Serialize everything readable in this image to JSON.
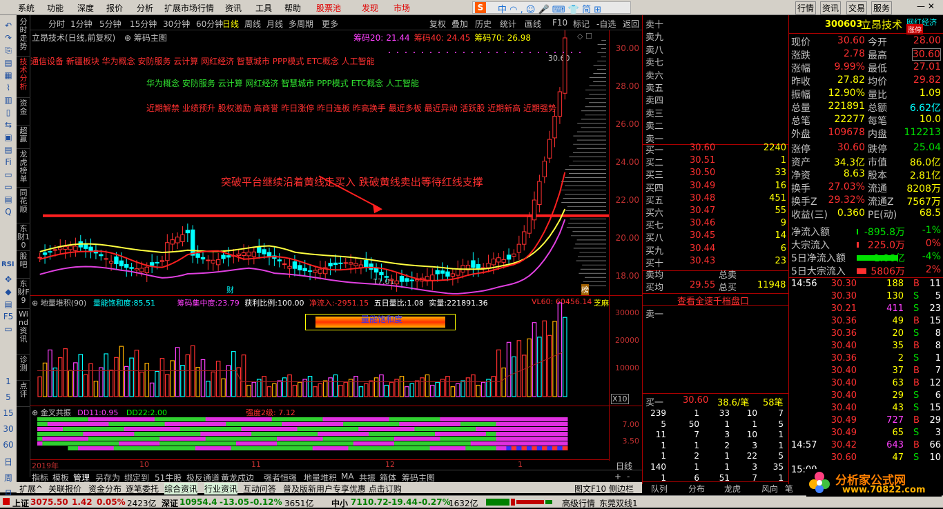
{
  "menu": {
    "items": [
      "系统",
      "功能",
      "深度",
      "报价",
      "分析",
      "扩展市场行情",
      "资讯",
      "工具",
      "帮助"
    ],
    "stock_pool": "股票池",
    "discover": "发现",
    "market": "市场",
    "right_items": [
      "行情",
      "资讯",
      "交易",
      "服务"
    ]
  },
  "vtabs": [
    "分时走势",
    "技术分析",
    "资金",
    "超赢",
    "龙虎榜单",
    "同花顺",
    "东财10",
    "股吧",
    "东财F9",
    "Wind资讯",
    "诊测",
    "点评"
  ],
  "left_numbers": [
    "1",
    "5",
    "15",
    "30",
    "60",
    "日",
    "周",
    "月"
  ],
  "toolbar": {
    "periods": [
      "分时",
      "1分钟",
      "5分钟",
      "15分钟",
      "30分钟",
      "60分钟",
      "日线",
      "周线",
      "月线",
      "多周期",
      "更多"
    ],
    "active": "日线",
    "tools": [
      "复权",
      "叠加",
      "历史",
      "统计",
      "画线",
      "F10",
      "标记",
      "-自选",
      "返回"
    ]
  },
  "chart": {
    "title": "立昂技术(日线,前复权)",
    "indicator": "筹码主图",
    "chips": [
      {
        "label": "筹码20:",
        "value": "21.44",
        "color": "#ff40ff"
      },
      {
        "label": "筹码40:",
        "value": "24.45",
        "color": "#ff3030"
      },
      {
        "label": "筹码70:",
        "value": "26.98",
        "color": "#ffff00"
      }
    ],
    "concept_line1": "通信设备 新疆板块 华为概念 安防服务 云计算 网红经济 智慧城市 PPP模式 ETC概念 人工智能",
    "concept_line2": "华为概念 安防服务 云计算 网红经济 智慧城市 PPP模式 ETC概念 人工智能",
    "tags_line": "近期解禁 业绩预升 股权激励 高商誉 昨日涨停 昨日连板 昨高换手 最近多板 最近异动 活跃股 近期新高 近期强势",
    "annotation": "突破平台继续沿着黄线走买入 跌破黄线卖出等待红线支撑",
    "high_label": "30.60",
    "low_label": "17.01",
    "marker_cai": "财",
    "marker_bang": "榜",
    "price_ticks": [
      "30.00",
      "28.00",
      "26.00",
      "24.00",
      "22.00",
      "20.00",
      "18.00"
    ]
  },
  "chart_data": {
    "type": "candlestick",
    "series": [
      {
        "name": "筹码20",
        "last": 21.44
      },
      {
        "name": "筹码40",
        "last": 24.45
      },
      {
        "name": "筹码70",
        "last": 26.98
      }
    ],
    "high": 30.6,
    "low": 17.01,
    "ylim": [
      17,
      31
    ]
  },
  "vol": {
    "title": "地量堆积(90)",
    "sat_label": "量能饱和度:",
    "sat_value": "85.51",
    "conc_label": "筹码集中度:",
    "conc_value": "23.79",
    "profit_label": "获利比例:",
    "profit_value": "100.00",
    "inflow_label": "净流入:",
    "inflow_value": "-2951.15",
    "ratio_label": "五日量比:",
    "ratio_value": "1.08",
    "real_label": "实量:",
    "real_value": "221891.36",
    "vl60": "VL60: 60456.14",
    "box_label": "量能饱和度",
    "extra": "芝麻",
    "ticks": [
      "30000",
      "20000",
      "10000"
    ],
    "x10": "X10"
  },
  "kd": {
    "title": "金叉共振",
    "dd11_label": "DD11:",
    "dd11": "0.95",
    "dd22_label": "DD22:",
    "dd22": "2.00",
    "strength": "强度2级: 7.12",
    "ticks": [
      "7.00",
      "3.50"
    ]
  },
  "dates": {
    "year": "2019年",
    "m10": "10",
    "m11": "11",
    "m12": "12",
    "m1": "1",
    "period": "日线"
  },
  "bottomtabs": [
    "指标",
    "模板",
    "管理",
    "另存为",
    "绑定到",
    "51牛股",
    "极反通道",
    "黄龙戍边",
    "强者恒强",
    "地量堆积",
    "MA",
    "共振",
    "箱体",
    "筹码主图"
  ],
  "subtabs": [
    "扩展^",
    "关联报价",
    "资金分布",
    "逐笔委托",
    "综合资讯",
    "行业资讯",
    "互动问答",
    "普及版新用户专享优惠 点击订购"
  ],
  "sidebar_label": "图文F10 侧边栏",
  "status": {
    "sh_name": "上证",
    "sh_price": "3075.50",
    "sh_chg": "1.42",
    "sh_pct": "0.05%",
    "sh_amt": "2423亿",
    "sz_name": "深证",
    "sz_price": "10954.4",
    "sz_chg": "-13.05",
    "sz_pct": "-0.12%",
    "sz_amt": "3651亿",
    "zx_name": "中小",
    "zx_price": "7110.72",
    "zx_chg": "-19.44",
    "zx_pct": "-0.27%",
    "zx_amt": "1632亿",
    "server": "高级行情_东莞双线1"
  },
  "orderbook": {
    "sells": [
      {
        "l": "卖十",
        "p": "",
        "v": ""
      },
      {
        "l": "卖九",
        "p": "",
        "v": ""
      },
      {
        "l": "卖八",
        "p": "",
        "v": ""
      },
      {
        "l": "卖七",
        "p": "",
        "v": ""
      },
      {
        "l": "卖六",
        "p": "",
        "v": ""
      },
      {
        "l": "卖五",
        "p": "",
        "v": ""
      },
      {
        "l": "卖四",
        "p": "",
        "v": ""
      },
      {
        "l": "卖三",
        "p": "",
        "v": ""
      },
      {
        "l": "卖二",
        "p": "",
        "v": ""
      },
      {
        "l": "卖一",
        "p": "",
        "v": ""
      }
    ],
    "buys": [
      {
        "l": "买一",
        "p": "30.60",
        "v": "2240"
      },
      {
        "l": "买二",
        "p": "30.51",
        "v": "1"
      },
      {
        "l": "买三",
        "p": "30.50",
        "v": "33"
      },
      {
        "l": "买四",
        "p": "30.49",
        "v": "16"
      },
      {
        "l": "买五",
        "p": "30.48",
        "v": "451"
      },
      {
        "l": "买六",
        "p": "30.47",
        "v": "55"
      },
      {
        "l": "买七",
        "p": "30.46",
        "v": "9"
      },
      {
        "l": "买八",
        "p": "30.45",
        "v": "14"
      },
      {
        "l": "买九",
        "p": "30.44",
        "v": "6"
      },
      {
        "l": "买十",
        "p": "30.43",
        "v": "23"
      }
    ],
    "sell_avg_label": "卖均",
    "sell_total_label": "总卖",
    "buy_avg_label": "买均",
    "buy_avg": "29.55",
    "buy_total_label": "总买",
    "buy_total": "11948",
    "full_link": "查看全速千档盘口",
    "sell1": "卖一",
    "buy1_label": "买一",
    "buy1_price": "30.60",
    "buy1_avg": "38.6/笔",
    "buy1_count": "58笔",
    "queue": [
      [
        "239",
        "1",
        "33",
        "10",
        "7"
      ],
      [
        "5",
        "50",
        "1",
        "1",
        "5"
      ],
      [
        "11",
        "7",
        "3",
        "10",
        "1"
      ],
      [
        "1",
        "1",
        "2",
        "3",
        "1"
      ],
      [
        "1",
        "2",
        "1",
        "22",
        "5"
      ],
      [
        "140",
        "1",
        "1",
        "3",
        "35"
      ],
      [
        "1",
        "6",
        "51",
        "7",
        "1"
      ]
    ],
    "tabs": [
      "队列",
      "分布",
      "龙虎",
      "风向",
      "笔"
    ]
  },
  "quote": {
    "code": "300603",
    "name": "立昂技术",
    "tag": "网红经济",
    "limit": "涨停",
    "rows": [
      [
        "现价",
        "30.60",
        "今开",
        "28.00"
      ],
      [
        "涨跌",
        "2.78",
        "最高",
        "30.60"
      ],
      [
        "涨幅",
        "9.99%",
        "最低",
        "27.01"
      ],
      [
        "昨收",
        "27.82",
        "均价",
        "29.82"
      ],
      [
        "振幅",
        "12.90%",
        "量比",
        "1.09"
      ],
      [
        "总量",
        "221891",
        "总额",
        "6.62亿"
      ],
      [
        "总笔",
        "22277",
        "每笔",
        "10.0"
      ],
      [
        "外盘",
        "109678",
        "内盘",
        "112213"
      ],
      [
        "涨停",
        "30.60",
        "跌停",
        "25.04"
      ],
      [
        "资产",
        "34.3亿",
        "市值",
        "86.0亿"
      ],
      [
        "净资",
        "8.63",
        "股本",
        "2.81亿"
      ],
      [
        "换手",
        "27.03%",
        "流通",
        "8208万"
      ],
      [
        "换手Z",
        "29.32%",
        "流通Z",
        "7567万"
      ],
      [
        "收益(三)",
        "0.360",
        "PE(动)",
        "68.5"
      ]
    ],
    "flows": [
      [
        "净流入额",
        "-895.8万",
        "-1%"
      ],
      [
        "大宗流入",
        "225.0万",
        "0%"
      ],
      [
        "5日净流入额",
        "-1.06亿",
        "-4%"
      ],
      [
        "5日大宗流入",
        "5806万",
        "2%"
      ]
    ],
    "ticks": [
      [
        "14:56",
        "30.30",
        "188",
        "B",
        "11"
      ],
      [
        "",
        "30.30",
        "130",
        "S",
        "5"
      ],
      [
        "",
        "30.21",
        "411",
        "S",
        "23"
      ],
      [
        "",
        "30.36",
        "49",
        "B",
        "15"
      ],
      [
        "",
        "30.36",
        "20",
        "S",
        "8"
      ],
      [
        "",
        "30.40",
        "35",
        "B",
        "8"
      ],
      [
        "",
        "30.36",
        "2",
        "S",
        "1"
      ],
      [
        "",
        "30.40",
        "37",
        "B",
        "7"
      ],
      [
        "",
        "30.40",
        "63",
        "B",
        "12"
      ],
      [
        "",
        "30.40",
        "29",
        "S",
        "6"
      ],
      [
        "",
        "30.40",
        "43",
        "S",
        "15"
      ],
      [
        "",
        "30.49",
        "727",
        "B",
        "29"
      ],
      [
        "",
        "30.49",
        "65",
        "S",
        "3"
      ],
      [
        "14:57",
        "30.42",
        "643",
        "B",
        "66"
      ],
      [
        "",
        "30.60",
        "47",
        "S",
        "10"
      ],
      [
        "15:00",
        "",
        "",
        "",
        ""
      ]
    ]
  },
  "watermark": {
    "name": "分析家公式网",
    "url": "www.70822.com"
  }
}
